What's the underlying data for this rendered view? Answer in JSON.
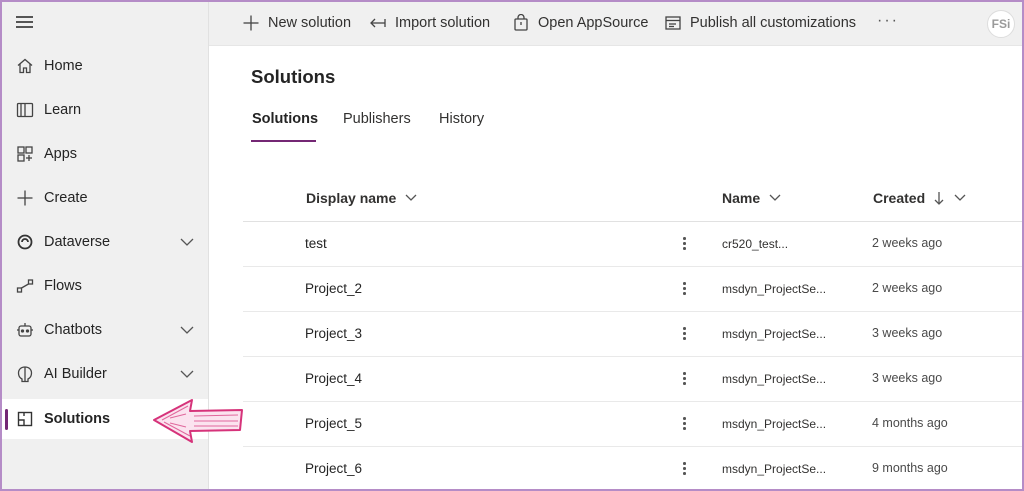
{
  "sidebar": {
    "items": [
      {
        "label": "Home",
        "icon": "home-icon"
      },
      {
        "label": "Learn",
        "icon": "book-icon"
      },
      {
        "label": "Apps",
        "icon": "apps-icon"
      },
      {
        "label": "Create",
        "icon": "plus-icon"
      },
      {
        "label": "Dataverse",
        "icon": "dataverse-icon",
        "expandable": true
      },
      {
        "label": "Flows",
        "icon": "flow-icon"
      },
      {
        "label": "Chatbots",
        "icon": "bot-icon",
        "expandable": true
      },
      {
        "label": "AI Builder",
        "icon": "brain-icon",
        "expandable": true
      },
      {
        "label": "Solutions",
        "icon": "solutions-icon",
        "active": true
      }
    ]
  },
  "commands": {
    "new_solution": "New solution",
    "import_solution": "Import solution",
    "open_appsource": "Open AppSource",
    "publish_all": "Publish all customizations",
    "more": "···"
  },
  "logo_text": "FSi",
  "page": {
    "title": "Solutions",
    "tabs": [
      "Solutions",
      "Publishers",
      "History"
    ],
    "selected_tab": "Solutions"
  },
  "table": {
    "columns": {
      "display_name": "Display name",
      "name": "Name",
      "created": "Created"
    },
    "sort": {
      "column": "Created",
      "direction": "descending"
    },
    "rows": [
      {
        "display_name": "test",
        "name": "cr520_test...",
        "created": "2 weeks ago"
      },
      {
        "display_name": "Project_2",
        "name": "msdyn_ProjectSe...",
        "created": "2 weeks ago"
      },
      {
        "display_name": "Project_3",
        "name": "msdyn_ProjectSe...",
        "created": "3 weeks ago"
      },
      {
        "display_name": "Project_4",
        "name": "msdyn_ProjectSe...",
        "created": "3 weeks ago"
      },
      {
        "display_name": "Project_5",
        "name": "msdyn_ProjectSe...",
        "created": "4 months ago"
      },
      {
        "display_name": "Project_6",
        "name": "msdyn_ProjectSe...",
        "created": "9 months ago"
      }
    ]
  },
  "colors": {
    "accent": "#742774",
    "annotation_arrow": "#d6337a",
    "sidebar_bg": "#f0f0f0",
    "border": "#b58cc7"
  }
}
